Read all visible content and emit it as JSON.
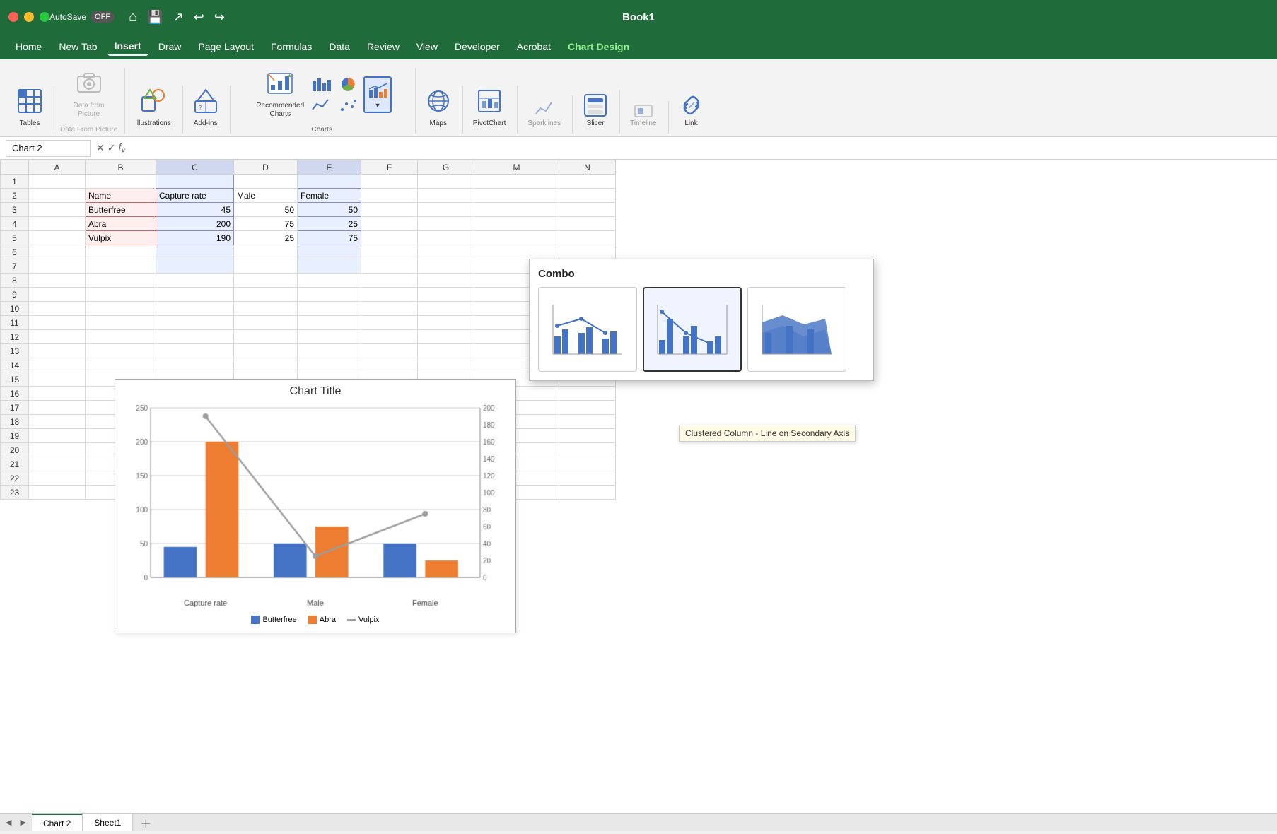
{
  "titleBar": {
    "appName": "Book1",
    "autosaveLabel": "AutoSave",
    "autosaveState": "OFF",
    "trafficLights": [
      "red",
      "yellow",
      "green"
    ]
  },
  "menuBar": {
    "items": [
      {
        "label": "Home",
        "active": false
      },
      {
        "label": "New Tab",
        "active": false
      },
      {
        "label": "Insert",
        "active": true
      },
      {
        "label": "Draw",
        "active": false
      },
      {
        "label": "Page Layout",
        "active": false
      },
      {
        "label": "Formulas",
        "active": false
      },
      {
        "label": "Data",
        "active": false
      },
      {
        "label": "Review",
        "active": false
      },
      {
        "label": "View",
        "active": false
      },
      {
        "label": "Developer",
        "active": false
      },
      {
        "label": "Acrobat",
        "active": false
      },
      {
        "label": "Chart Design",
        "active": false,
        "special": true
      }
    ]
  },
  "ribbon": {
    "groups": [
      {
        "label": "Tables",
        "items": [
          {
            "label": "Tables",
            "icon": "table"
          }
        ]
      },
      {
        "label": "Data From Picture",
        "items": [
          {
            "label": "Data from\nPicture",
            "icon": "picture",
            "disabled": true
          }
        ]
      },
      {
        "label": "Illustrations",
        "items": [
          {
            "label": "Illustrations",
            "icon": "shapes"
          }
        ]
      },
      {
        "label": "Add-ins",
        "items": [
          {
            "label": "Add-ins",
            "icon": "addins"
          }
        ]
      },
      {
        "label": "Charts",
        "items": [
          {
            "label": "Recommended\nCharts",
            "icon": "rec-charts"
          },
          {
            "label": "Column/Bar",
            "icon": "column"
          },
          {
            "label": "Line/Area",
            "icon": "line"
          },
          {
            "label": "Pie/Donut",
            "icon": "pie"
          },
          {
            "label": "Scatter",
            "icon": "scatter"
          },
          {
            "label": "Combo",
            "icon": "combo",
            "active": true
          }
        ]
      },
      {
        "label": "Maps",
        "items": [
          {
            "label": "Maps",
            "icon": "maps"
          }
        ]
      },
      {
        "label": "PivotChart",
        "items": [
          {
            "label": "PivotChart",
            "icon": "pivotchart"
          }
        ]
      },
      {
        "label": "Sparklines",
        "items": [
          {
            "label": "Sparklines",
            "icon": "sparklines"
          }
        ]
      },
      {
        "label": "Slicer",
        "items": [
          {
            "label": "Slicer",
            "icon": "slicer"
          }
        ]
      },
      {
        "label": "Timeline",
        "items": [
          {
            "label": "Timeline",
            "icon": "timeline"
          }
        ]
      },
      {
        "label": "Links",
        "items": [
          {
            "label": "Link",
            "icon": "link"
          }
        ]
      }
    ]
  },
  "formulaBar": {
    "nameBox": "Chart 2",
    "formula": ""
  },
  "spreadsheet": {
    "columns": [
      "",
      "A",
      "B",
      "C",
      "D",
      "E",
      "F",
      "G",
      "M",
      "N"
    ],
    "rows": [
      {
        "num": 1,
        "cells": [
          "",
          "",
          "",
          "",
          "",
          "",
          ""
        ]
      },
      {
        "num": 2,
        "cells": [
          "",
          "Name",
          "Capture rate",
          "Male",
          "Female",
          "",
          ""
        ]
      },
      {
        "num": 3,
        "cells": [
          "",
          "Butterfree",
          "45",
          "50",
          "50",
          "",
          ""
        ]
      },
      {
        "num": 4,
        "cells": [
          "",
          "Abra",
          "200",
          "75",
          "25",
          "",
          ""
        ]
      },
      {
        "num": 5,
        "cells": [
          "",
          "Vulpix",
          "190",
          "25",
          "75",
          "",
          ""
        ]
      },
      {
        "num": 6,
        "cells": [
          "",
          "",
          "",
          "",
          "",
          "",
          ""
        ]
      },
      {
        "num": 7,
        "cells": [
          "",
          "",
          "",
          "",
          "",
          "",
          ""
        ]
      }
    ]
  },
  "comboPopup": {
    "title": "Combo",
    "charts": [
      {
        "id": 0,
        "label": "Clustered Column - Line",
        "active": false
      },
      {
        "id": 1,
        "label": "Clustered Column - Line on Secondary Axis",
        "active": true
      },
      {
        "id": 2,
        "label": "Stacked Area - Clustered Column",
        "active": false
      }
    ],
    "tooltip": "Clustered Column - Line on Secondary Axis"
  },
  "embeddedChart": {
    "title": "Chart Title",
    "series": [
      {
        "name": "Butterfree",
        "color": "#4472c4",
        "values": [
          45,
          50,
          50
        ]
      },
      {
        "name": "Abra",
        "color": "#ed7d31",
        "values": [
          200,
          75,
          25
        ]
      },
      {
        "name": "Vulpix",
        "color": "#9e9e9e",
        "values": [
          190,
          25,
          75
        ],
        "type": "line"
      }
    ],
    "categories": [
      "Capture rate",
      "Male",
      "Female"
    ],
    "leftAxis": {
      "max": 250,
      "ticks": [
        0,
        50,
        100,
        150,
        200,
        250
      ]
    },
    "rightAxis": {
      "max": 200,
      "ticks": [
        0,
        20,
        40,
        60,
        80,
        100,
        120,
        140,
        160,
        180,
        200
      ]
    }
  },
  "tabs": [
    {
      "label": "Chart 2",
      "active": true
    },
    {
      "label": "Sheet1",
      "active": false
    }
  ]
}
